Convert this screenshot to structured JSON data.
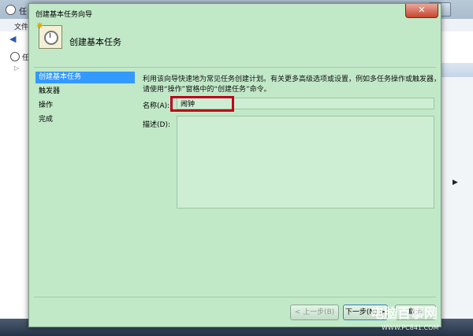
{
  "background_window": {
    "title": "任",
    "menu_file": "文件",
    "back_arrow": "◀",
    "tree_label": "任",
    "tree_expander": "▷",
    "right_arrow": "▶"
  },
  "dialog": {
    "title": "创建基本任务向导",
    "close_label": "✕",
    "header_title": "创建基本任务",
    "steps": [
      {
        "label": "创建基本任务",
        "active": true
      },
      {
        "label": "触发器",
        "active": false
      },
      {
        "label": "操作",
        "active": false
      },
      {
        "label": "完成",
        "active": false
      }
    ],
    "description": "利用该向导快速地为常见任务创建计划。有关更多高级选项或设置，例如多任务操作或触发器，请使用“操作”窗格中的“创建任务”命令。",
    "name_label": "名称(A):",
    "name_value": "闹钟",
    "desc_label": "描述(D):",
    "desc_value": "",
    "buttons": {
      "back": "< 上一步(B)",
      "next": "下一步(N) >",
      "cancel": "取消"
    }
  },
  "watermark": {
    "logo": "电脑百事网",
    "url": "WWW.PC841.COM"
  },
  "colors": {
    "dialog_bg": "#c1e9c8",
    "selected_step": "#3399ff",
    "highlight_border": "#c0001a"
  }
}
